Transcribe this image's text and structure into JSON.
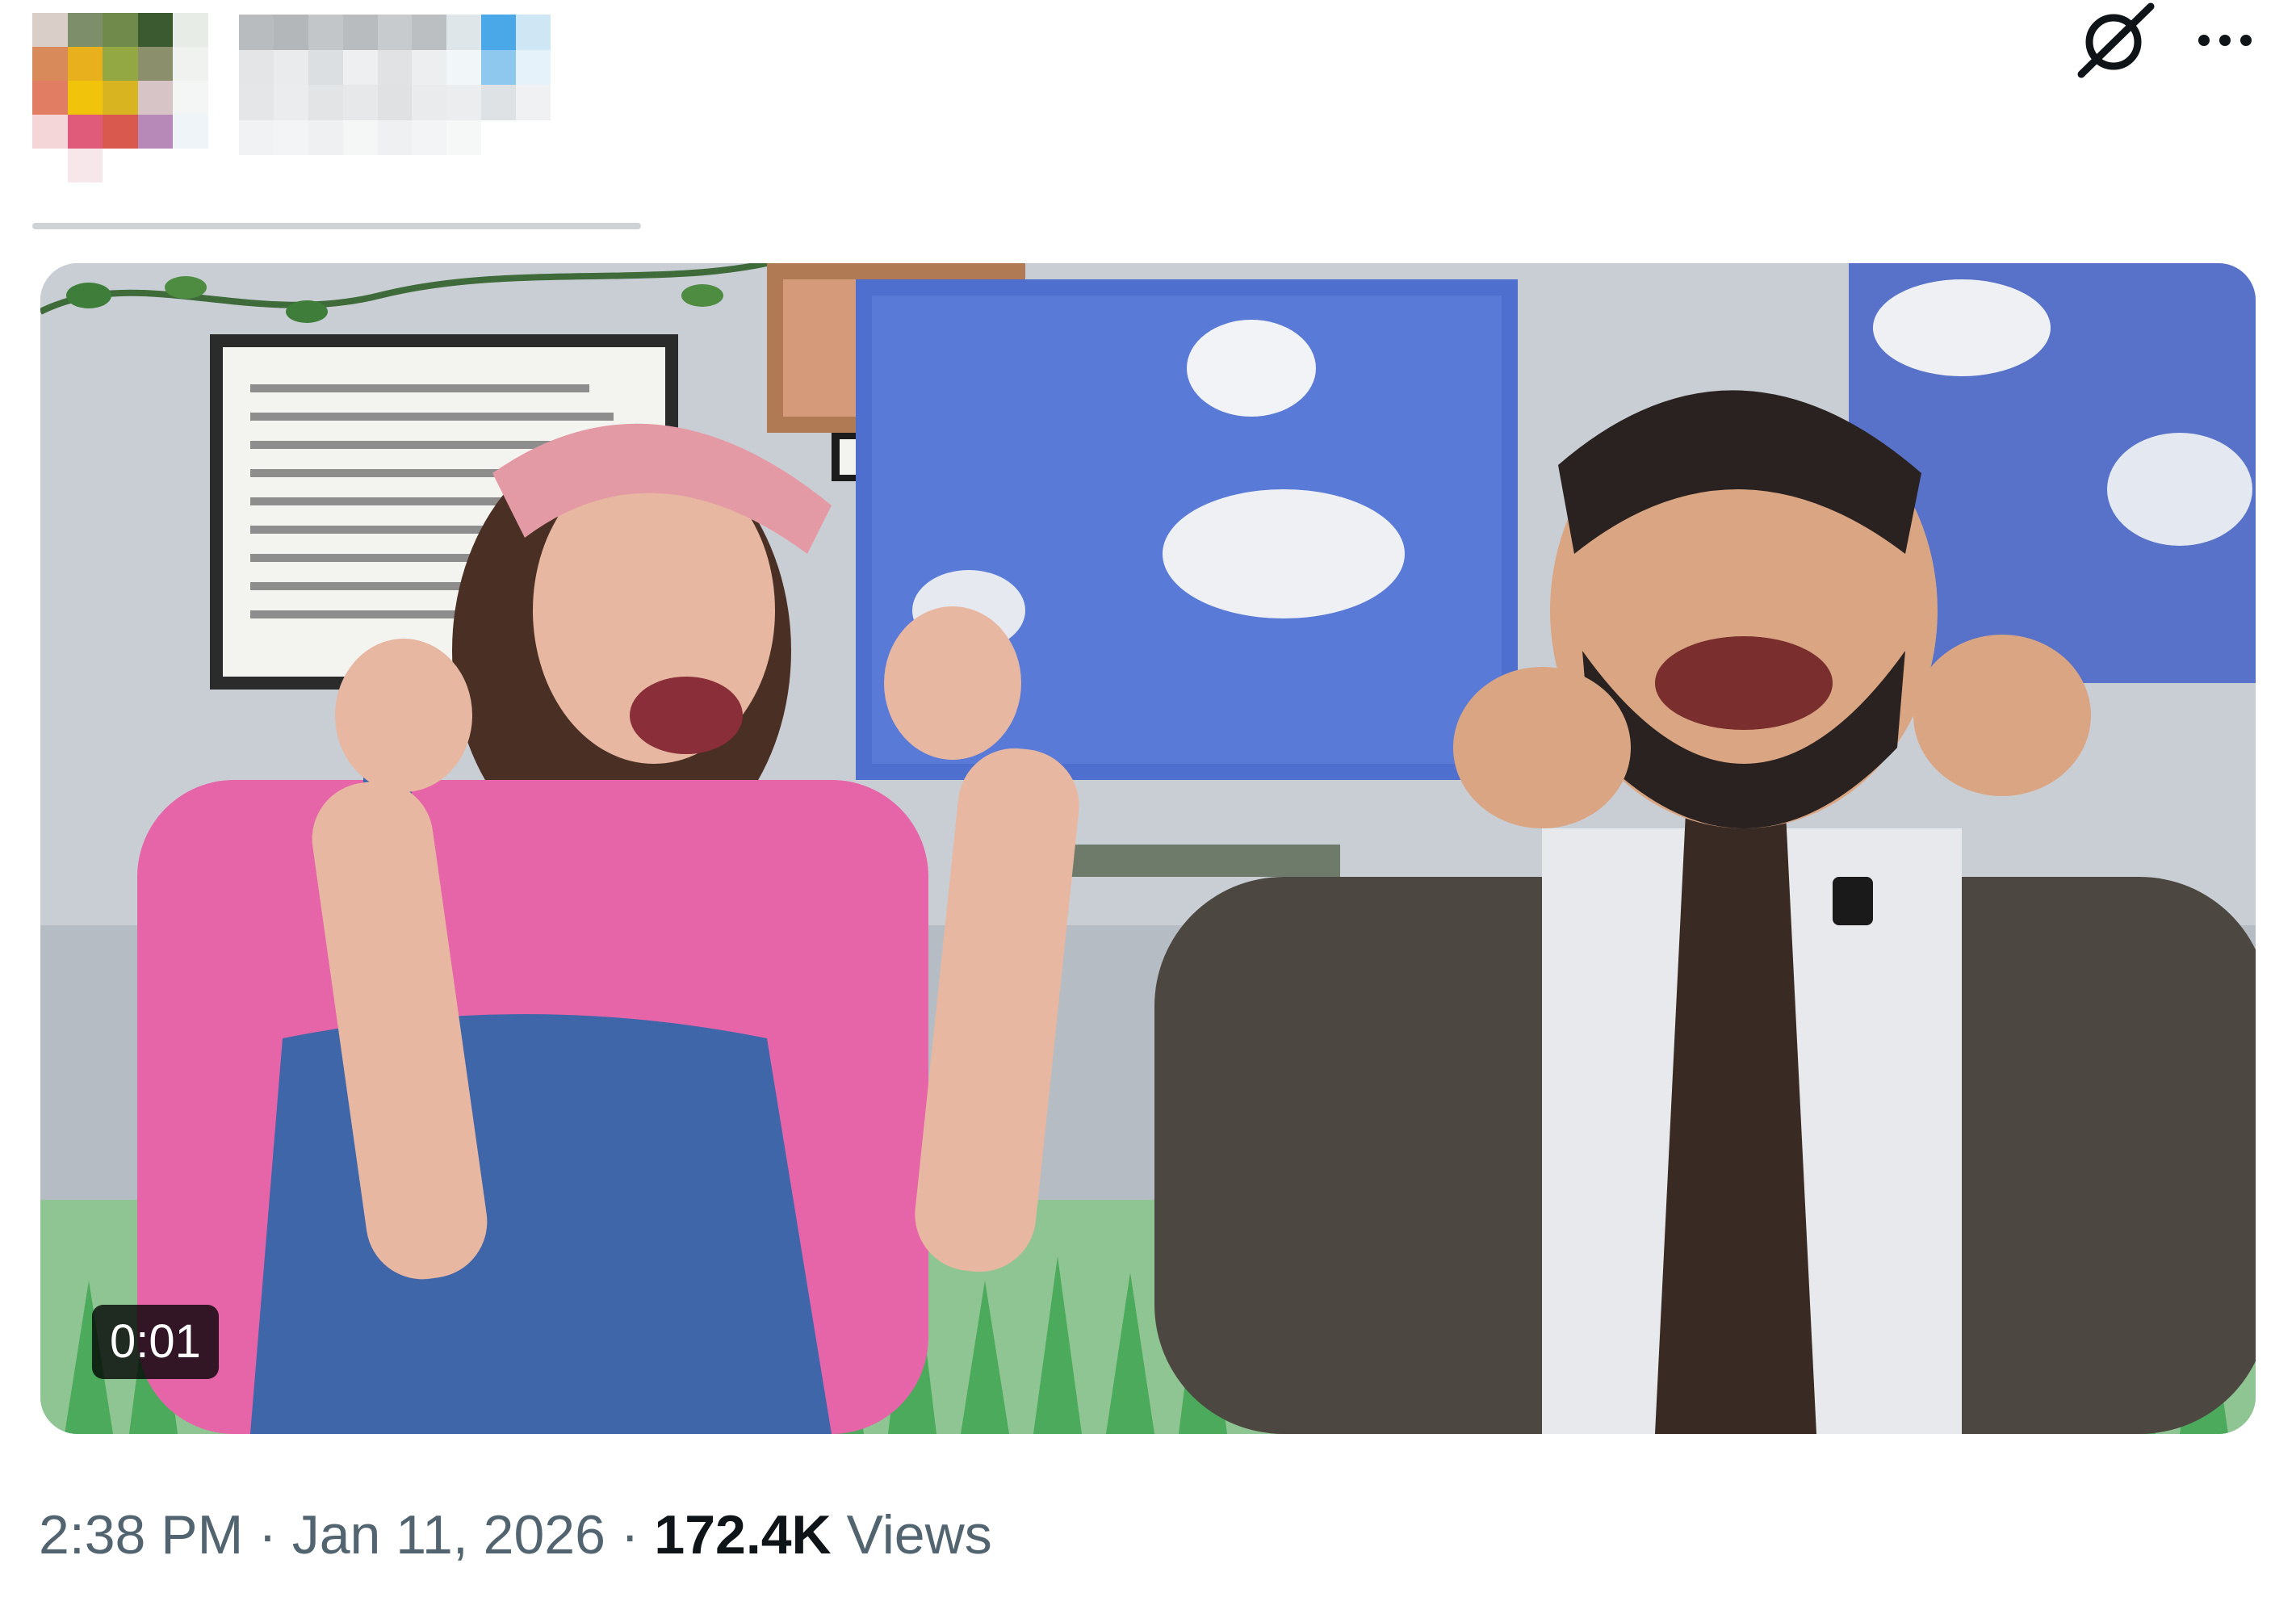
{
  "post": {
    "video": {
      "duration": "0:01"
    },
    "meta": {
      "time": "2:38 PM",
      "date": "Jan 11, 2026",
      "separator": "·",
      "views_count": "172.4K",
      "views_label": "Views"
    }
  },
  "icons": {
    "grok": "grok-slash-icon",
    "more": "more-horizontal-icon"
  },
  "colors": {
    "secondary_text": "#536471",
    "primary_text": "#0f1419",
    "badge_bg": "rgba(0,0,0,0.78)"
  }
}
